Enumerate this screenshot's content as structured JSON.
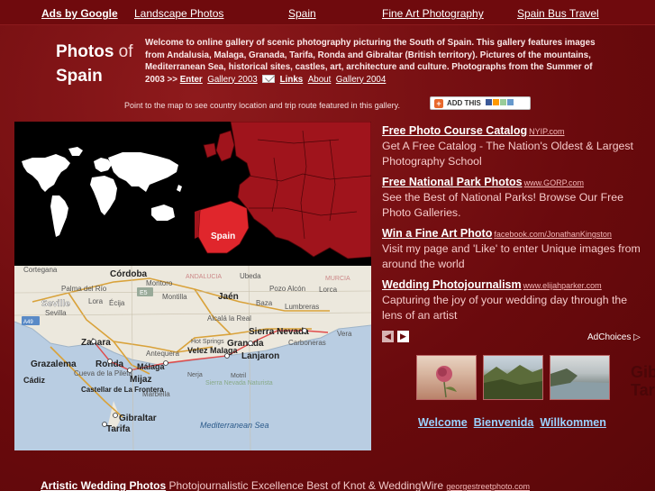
{
  "topnav": {
    "ads_label": "Ads by Google",
    "links": [
      "Landscape Photos",
      "Spain",
      "Fine Art Photography",
      "Spain Bus Travel"
    ]
  },
  "brand": {
    "photos": "Photos",
    "of": "of",
    "spain": "Spain"
  },
  "intro": {
    "text": "Welcome to online gallery of scenic photography picturing the South of Spain. This gallery features images from Andalusia, Malaga, Granada, Tarifa, Ronda and Gibraltar (British territory). Pictures of the mountains, Mediterranean Sea, historical sites, castles, art, architecture and culture. Photographs from the Summer of 2003 >>",
    "enter": "Enter",
    "gallery2003": "Gallery 2003",
    "links": "Links",
    "about": "About",
    "gallery2004": "Gallery 2004"
  },
  "map_hint": "Point to the map to see country location and trip route featured in this gallery.",
  "addthis_label": "ADD THIS",
  "europe_label": "Spain",
  "spain_map": {
    "places": [
      "Cortegana",
      "Córdoba",
      "Palma del Río",
      "Montoro",
      "ANDALUCIA",
      "Ubeda",
      "MURCIA",
      "Seville",
      "Sevilla",
      "Écija",
      "Lora",
      "E5",
      "Montilla",
      "Jaén",
      "Pozo Alcón",
      "Lorca",
      "Baza",
      "Lumbreras",
      "Alcalá la Real",
      "Zahara",
      "Antequera",
      "Sierra Nevada",
      "Vera",
      "Granada",
      "Hot Springs",
      "Carboneras",
      "Grazalema",
      "Ronda",
      "Málaga",
      "Velez Malaga",
      "Lanjaron",
      "Cueva de la Pileta",
      "Cádiz",
      "Mijaz",
      "Nerja",
      "Sierra Nevada Naturista",
      "Motril",
      "Castellar de La Frontera",
      "Marbella",
      "Gibraltar",
      "Tarifa",
      "Mediterranean Sea",
      "A49"
    ]
  },
  "ads": [
    {
      "title": "Free Photo Course Catalog",
      "url": "NYIP.com",
      "desc": "Get A Free Catalog - The Nation's Oldest & Largest Photography School"
    },
    {
      "title": "Free National Park Photos",
      "url": "www.GORP.com",
      "desc": "See the Best of National Parks! Browse Our Free Photo Galleries."
    },
    {
      "title": "Win a Fine Art Photo",
      "url": "facebook.com/JonathanKingston",
      "desc": "Visit my page and 'Like' to enter Unique images from around the world"
    },
    {
      "title": "Wedding Photojournalism",
      "url": "www.elijahparker.com",
      "desc": "Capturing the joy of your wedding day through the lens of an artist"
    }
  ],
  "pager": {
    "prev": "◀",
    "next": "▶"
  },
  "adchoices": "AdChoices",
  "languages": [
    "Welcome",
    "Bienvenida",
    "Willkommen"
  ],
  "watermark": [
    "Gib",
    "Tarifa"
  ],
  "bottom_ad": {
    "title": "Artistic Wedding Photos",
    "desc": "Photojournalistic Excellence Best of Knot & WeddingWire",
    "url": "georgestreetphoto.com"
  },
  "colors": {
    "background": "#7a0d10",
    "europe_fill": "#a0141c",
    "spain_fill": "#e0262c",
    "link_blue": "#9ad2ff"
  }
}
